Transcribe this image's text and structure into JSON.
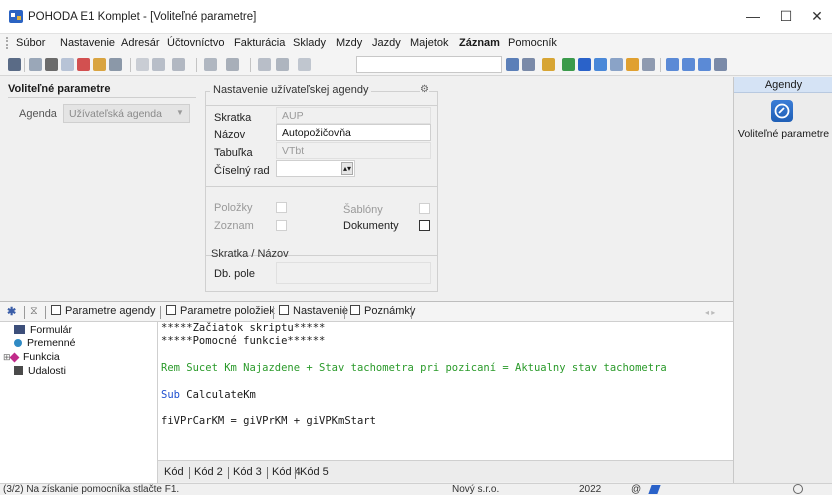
{
  "window": {
    "title": "POHODA E1 Komplet - [Voliteľné parametre]",
    "minimize": "—",
    "maximize": "☐",
    "close": "✕"
  },
  "menu": [
    "Súbor",
    "Nastavenie",
    "Adresár",
    "Účtovníctvo",
    "Fakturácia",
    "Sklady",
    "Mzdy",
    "Jazdy",
    "Majetok",
    "Záznam",
    "Pomocník"
  ],
  "right_panel": {
    "header": "Agendy",
    "item_label": "Voliteľné parametre"
  },
  "left_panel": {
    "heading": "Voliteľné parametre",
    "agenda_label": "Agenda",
    "agenda_value": "Užívateľská agenda"
  },
  "user_agenda": {
    "title": "Nastavenie užívateľskej agendy",
    "gear": "⚙",
    "skratka_label": "Skratka",
    "skratka_value": "AUP",
    "nazov_label": "Názov",
    "nazov_value": "Autopožičovňa",
    "tabulka_label": "Tabuľka",
    "tabulka_value": "VTbt",
    "ciselny_rad_label": "Číselný rad",
    "ciselny_rad_value": "",
    "polozky_label": "Položky",
    "zoznam_label": "Zoznam",
    "sablony_label": "Šablóny",
    "dokumenty_label": "Dokumenty",
    "sub_title": "Skratka / Názov",
    "db_pole_label": "Db. pole",
    "db_pole_value": ""
  },
  "tabs": {
    "star": "✱",
    "filter": "⧖",
    "items": [
      "Parametre agendy",
      "Parametre položiek",
      "Nastavenie",
      "Poznámky"
    ],
    "arrows": "◂ ▸"
  },
  "tree": {
    "items": [
      "Formulár",
      "Premenné",
      "Funkcia",
      "Udalosti"
    ]
  },
  "code": {
    "lines": [
      "*****Začiatok skriptu*****",
      "*****Pomocné funkcie******",
      "",
      "Rem Sucet Km Najazdene + Stav tachometra pri pozicaní = Aktualny stav tachometra",
      "",
      "Sub",
      "",
      "fiVPrCarKM = giVPrKM + giVPKmStart"
    ],
    "sub_name": "CalculateKm",
    "tabs": [
      "Kód",
      "Kód 2",
      "Kód 3",
      "Kód 4",
      "Kód 5"
    ]
  },
  "status": {
    "hint": "(3/2) Na získanie pomocníka stlačte F1.",
    "company": "Nový s.r.o.",
    "year": "2022",
    "at": "@"
  },
  "colors": {
    "code_green": "#2a9a2a",
    "code_blue": "#1f4fd0",
    "accent_blue": "#1f5fb6"
  }
}
